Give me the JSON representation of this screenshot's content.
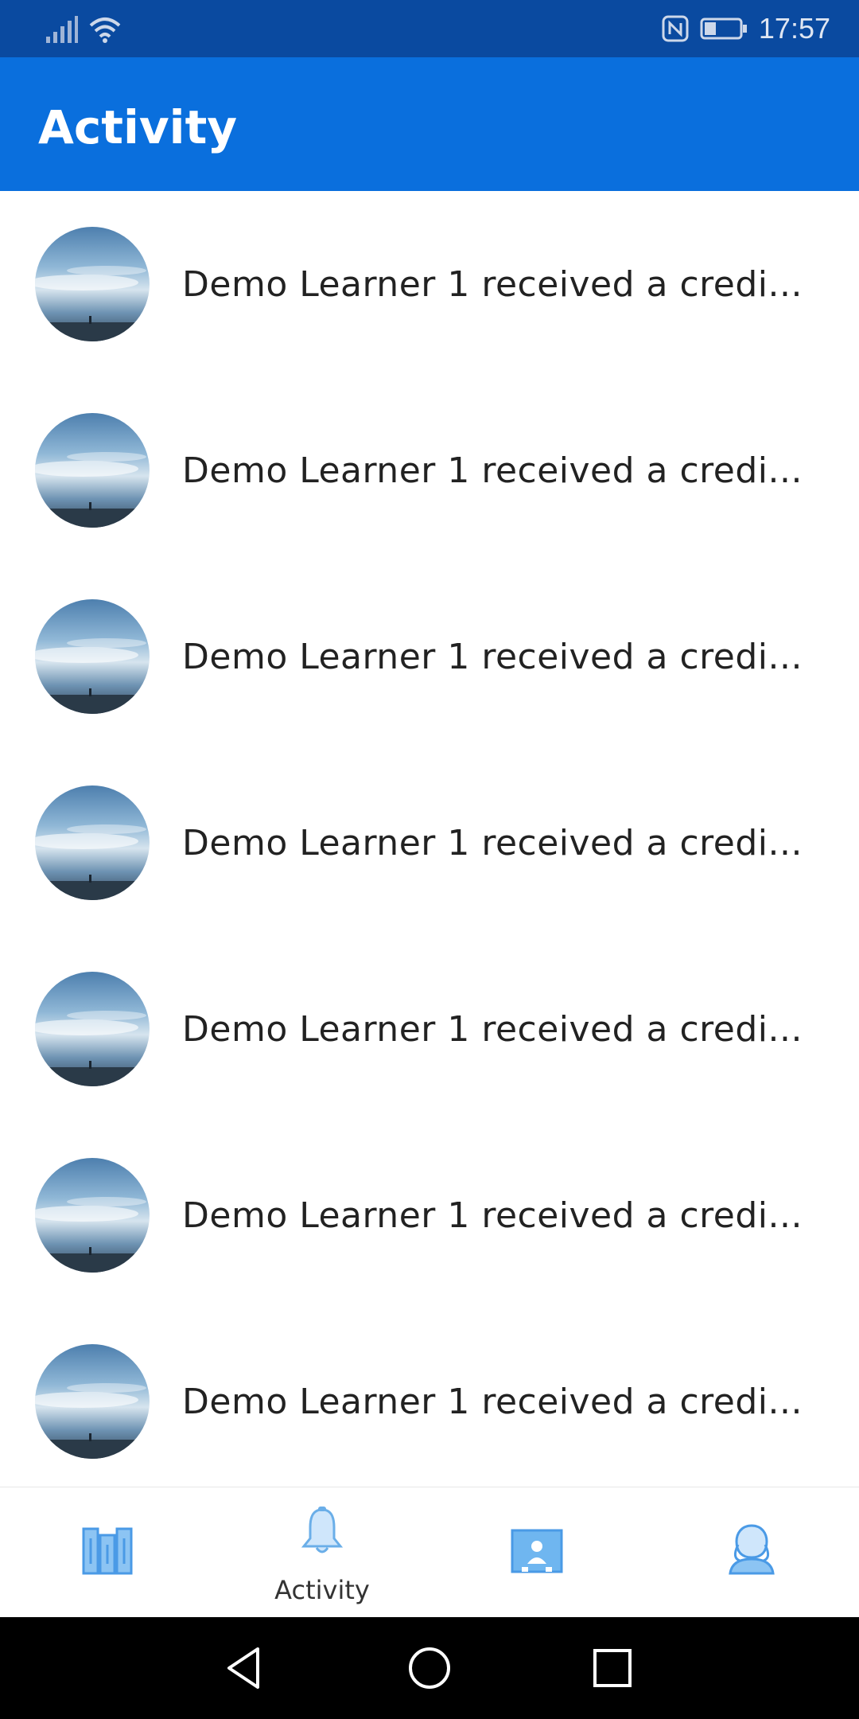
{
  "status_bar": {
    "time": "17:57",
    "icons": [
      "signal-icon",
      "wifi-icon",
      "nfc-icon",
      "battery-icon"
    ]
  },
  "app_bar": {
    "title": "Activity"
  },
  "feed": {
    "items": [
      {
        "text": "Demo Learner 1 received a credi...",
        "avatar": "landscape-sky-avatar"
      },
      {
        "text": "Demo Learner 1 received a credi...",
        "avatar": "landscape-sky-avatar"
      },
      {
        "text": "Demo Learner 1 received a credi...",
        "avatar": "landscape-sky-avatar"
      },
      {
        "text": "Demo Learner 1 received a credi...",
        "avatar": "landscape-sky-avatar"
      },
      {
        "text": "Demo Learner 1 received a credi...",
        "avatar": "landscape-sky-avatar"
      },
      {
        "text": "Demo Learner 1 received a credi...",
        "avatar": "landscape-sky-avatar"
      },
      {
        "text": "Demo Learner 1 received a credi...",
        "avatar": "landscape-sky-avatar"
      }
    ]
  },
  "bottom_nav": {
    "tabs": [
      {
        "icon": "books-icon",
        "label": ""
      },
      {
        "icon": "bell-icon",
        "label": "Activity",
        "active": true
      },
      {
        "icon": "id-card-icon",
        "label": ""
      },
      {
        "icon": "user-profile-icon",
        "label": ""
      }
    ]
  },
  "colors": {
    "status_bar": "#0a4aa0",
    "app_bar": "#0a6fdd",
    "nav_icon": "#5aaaf0",
    "system_nav": "#000000"
  }
}
